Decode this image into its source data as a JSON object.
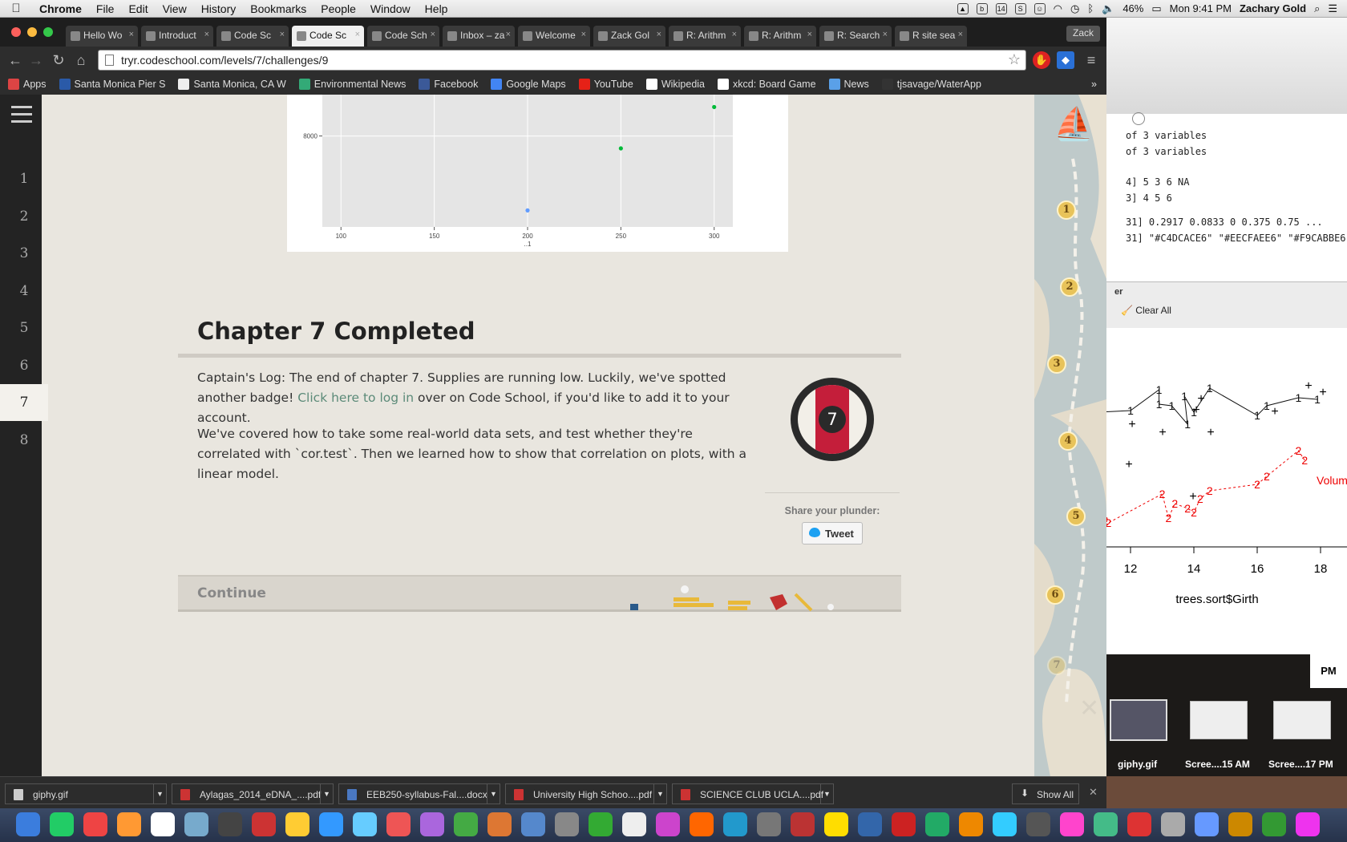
{
  "menubar": {
    "app": "Chrome",
    "menus": [
      "File",
      "Edit",
      "View",
      "History",
      "Bookmarks",
      "People",
      "Window",
      "Help"
    ],
    "battery": "46%",
    "clock": "Mon 9:41 PM",
    "user": "Zachary Gold"
  },
  "browser": {
    "tabs": [
      "Hello Wo",
      "Introduct",
      "Code Sc",
      "Code Sc",
      "Code Sch",
      "Inbox – za",
      "Welcome",
      "Zack Gol",
      "R: Arithm",
      "R: Arithm",
      "R: Search",
      "R site sea"
    ],
    "profile": "Zack",
    "url": "tryr.codeschool.com/levels/7/challenges/9",
    "bookmarks": [
      "Apps",
      "Santa Monica Pier S",
      "Santa Monica, CA W",
      "Environmental News",
      "Facebook",
      "Google Maps",
      "YouTube",
      "Wikipedia",
      "xkcd: Board Game",
      "News",
      "tjsavage/WaterApp"
    ],
    "bookmark_colors": [
      "#d44",
      "#2a5aa8",
      "#eee",
      "#3a7",
      "#3b5998",
      "#4285f4",
      "#e62117",
      "#fff",
      "#fff",
      "#5aa0e8",
      "#333"
    ]
  },
  "sidebar": {
    "levels": [
      "1",
      "2",
      "3",
      "4",
      "5",
      "6",
      "7",
      "8"
    ],
    "active_level": "7"
  },
  "chapter": {
    "title": "Chapter 7 Completed",
    "para1_pre": "Captain's Log: The end of chapter 7. Supplies are running low. Luckily, we've spotted another badge! ",
    "para1_link": "Click here to log in",
    "para1_post": " over on Code School, if you'd like to add it to your account.",
    "para2": "We've covered how to take some real-world data sets, and test whether they're correlated with `cor.test`. Then we learned how to show that correlation on plots, with a linear model.",
    "badge_number": "7",
    "share_label": "Share your plunder:",
    "tweet_label": "Tweet",
    "continue_label": "Continue"
  },
  "map": {
    "stops": [
      "1",
      "2",
      "3",
      "4",
      "5",
      "6",
      "7"
    ]
  },
  "chart_data": [
    {
      "type": "scatter",
      "x_ticks": [
        "100",
        "150",
        "200",
        "250",
        "300"
      ],
      "y_ticks": [
        "8000"
      ],
      "xlabel": "..1",
      "points": [
        {
          "x": 200,
          "y": 6200,
          "color": "#619cff"
        },
        {
          "x": 250,
          "y": 7700,
          "color": "#00ba38"
        },
        {
          "x": 300,
          "y": 8700,
          "color": "#00ba38"
        }
      ],
      "xlim": [
        90,
        310
      ],
      "ylim": [
        5800,
        9000
      ]
    },
    {
      "type": "scatter",
      "x_ticks": [
        "12",
        "14",
        "16",
        "18"
      ],
      "xlabel": "trees.sort$Girth",
      "series_label": "Volum",
      "series": [
        {
          "name": "1",
          "marker": "1",
          "color": "#111",
          "x": [
            11.0,
            12.0,
            12.9,
            12.9,
            13.3,
            13.8,
            13.7,
            14.0,
            14.5,
            16.0,
            16.3,
            17.3,
            17.9
          ]
        },
        {
          "name": "2",
          "marker": "2",
          "color": "#e00",
          "dashed": true,
          "x": [
            11.2,
            11.3,
            13.0,
            13.2,
            13.4,
            13.8,
            14.0,
            14.2,
            14.5,
            16.0,
            16.3,
            17.3,
            17.5
          ]
        }
      ]
    }
  ],
  "r_console": {
    "lines": [
      "of 3 variables",
      "of 3 variables",
      "4] 5 3 6 NA",
      "3] 4 5 6",
      "31] 0.2917 0.0833 0 0.375 0.75 ...",
      "31] \"#C4DCACE6\" \"#EECFAEE6\" \"#F9CABBE6\""
    ],
    "pane_label": "er",
    "clear_label": "Clear All"
  },
  "desktop": {
    "pm": "PM",
    "thumbs": [
      "giphy.gif",
      "Scree....15 AM",
      "Scree....17 PM"
    ]
  },
  "downloads": {
    "items": [
      "giphy.gif",
      "Aylagas_2014_eDNA_....pdf",
      "EEB250-syllabus-Fal....docx",
      "University High Schoo....pdf",
      "SCIENCE CLUB UCLA....pdf"
    ],
    "show_all": "Show All"
  },
  "dock_colors": [
    "#3b7ddd",
    "#2c6",
    "#e44",
    "#f93",
    "#fff",
    "#7ac",
    "#444",
    "#c33",
    "#fc3",
    "#39f",
    "#6cf",
    "#e55",
    "#a6d",
    "#4a4",
    "#d73",
    "#58c",
    "#888",
    "#3a3",
    "#eee",
    "#c4c",
    "#f60",
    "#29c",
    "#777",
    "#b33",
    "#fd0",
    "#36a",
    "#c22",
    "#2a6",
    "#e80",
    "#3cf",
    "#555",
    "#f4c",
    "#4b8",
    "#d33",
    "#aaa",
    "#69f",
    "#c80",
    "#393",
    "#e3e"
  ]
}
